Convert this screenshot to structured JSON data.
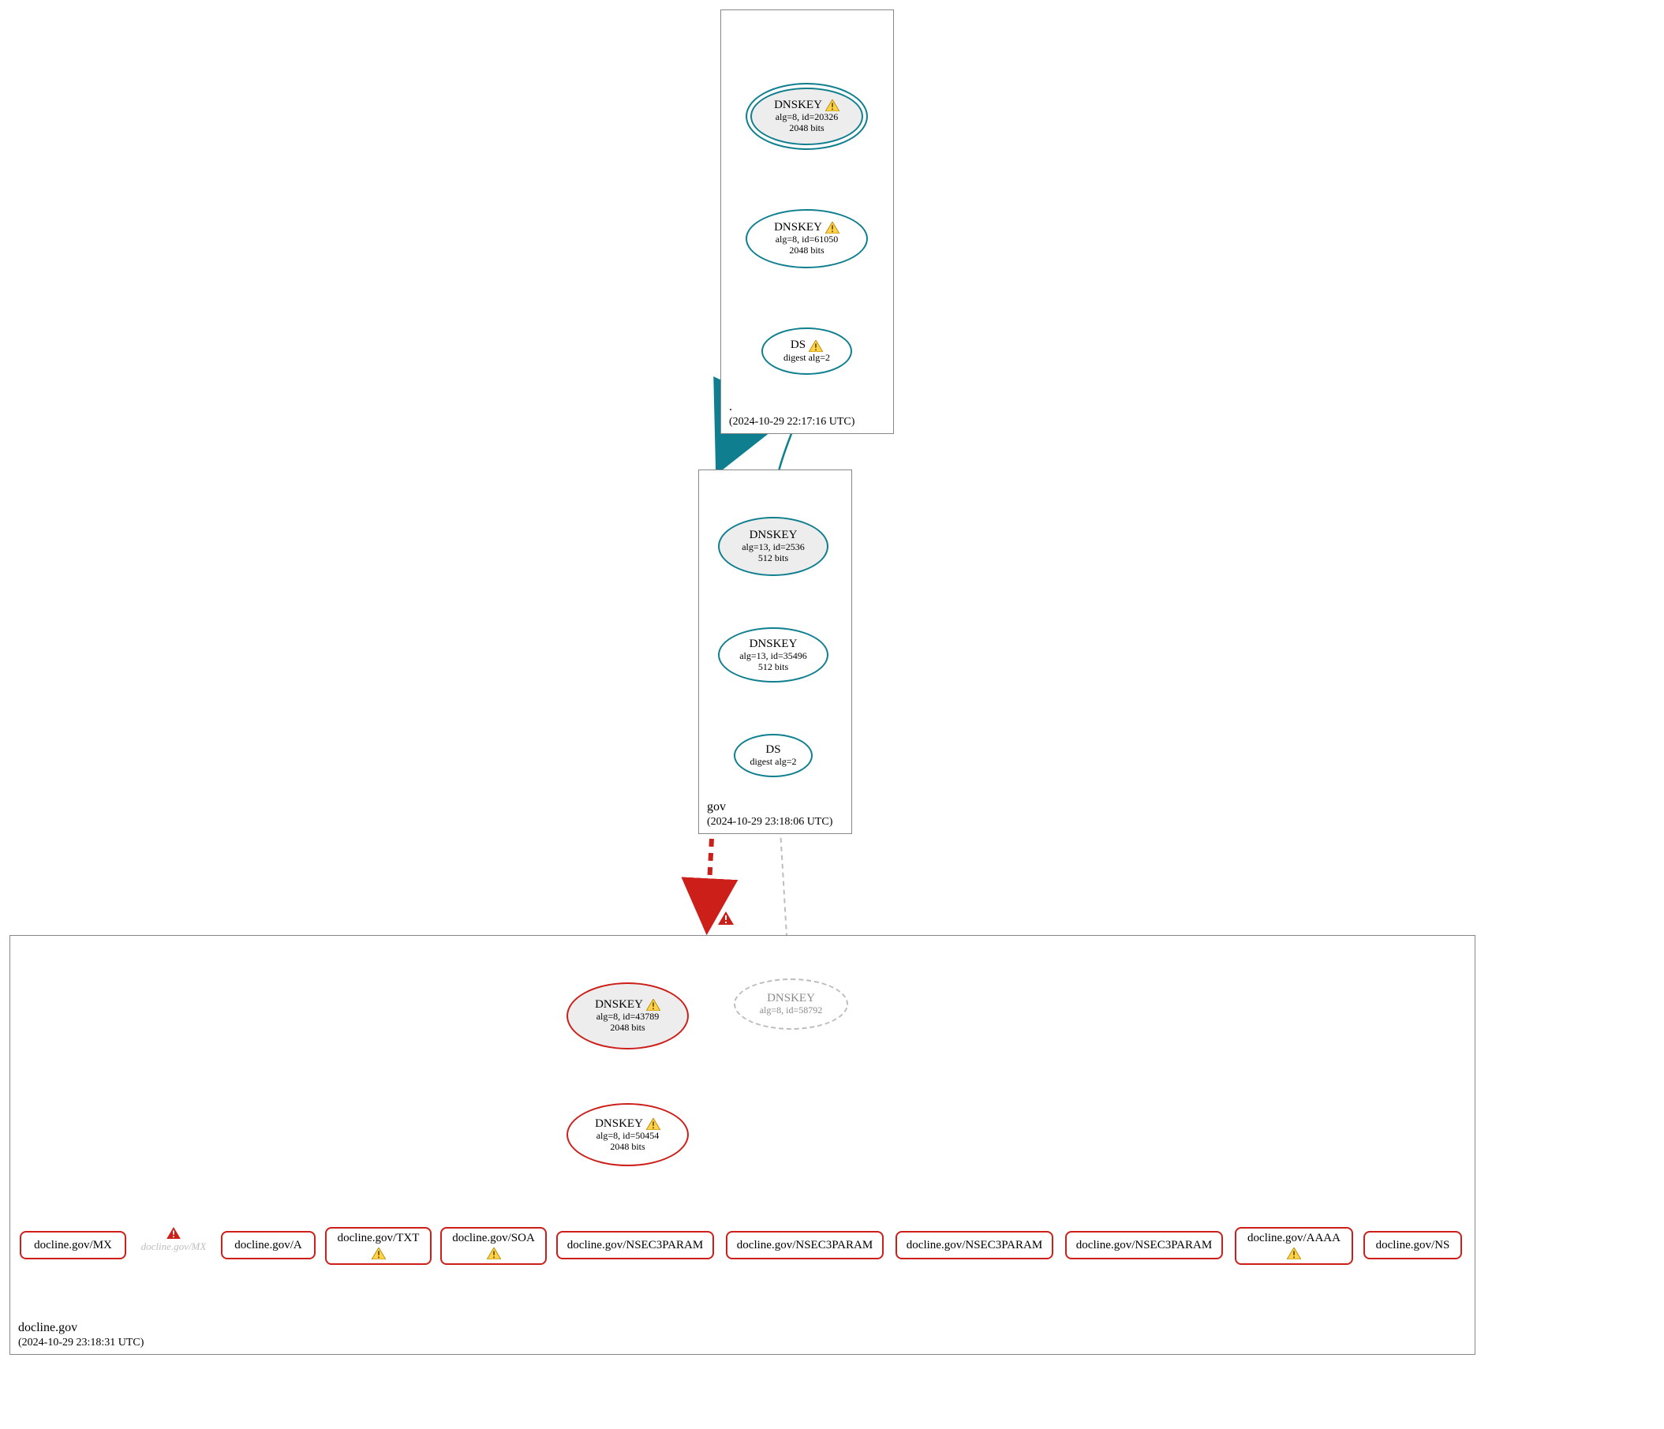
{
  "zones": {
    "root": {
      "label": ".",
      "timestamp": "(2024-10-29 22:17:16 UTC)"
    },
    "gov": {
      "label": "gov",
      "timestamp": "(2024-10-29 23:18:06 UTC)"
    },
    "docline": {
      "label": "docline.gov",
      "timestamp": "(2024-10-29 23:18:31 UTC)"
    }
  },
  "nodes": {
    "root_ksk": {
      "title": "DNSKEY",
      "line1": "alg=8, id=20326",
      "line2": "2048 bits",
      "warn": true
    },
    "root_zsk": {
      "title": "DNSKEY",
      "line1": "alg=8, id=61050",
      "line2": "2048 bits",
      "warn": true
    },
    "root_ds": {
      "title": "DS",
      "line1": "digest alg=2",
      "line2": "",
      "warn": true
    },
    "gov_ksk": {
      "title": "DNSKEY",
      "line1": "alg=13, id=2536",
      "line2": "512 bits",
      "warn": false
    },
    "gov_zsk": {
      "title": "DNSKEY",
      "line1": "alg=13, id=35496",
      "line2": "512 bits",
      "warn": false
    },
    "gov_ds": {
      "title": "DS",
      "line1": "digest alg=2",
      "line2": "",
      "warn": false
    },
    "doc_ksk": {
      "title": "DNSKEY",
      "line1": "alg=8, id=43789",
      "line2": "2048 bits",
      "warn": true
    },
    "doc_zsk": {
      "title": "DNSKEY",
      "line1": "alg=8, id=50454",
      "line2": "2048 bits",
      "warn": true
    },
    "doc_inact": {
      "title": "DNSKEY",
      "line1": "alg=8, id=58792",
      "line2": "",
      "warn": false
    }
  },
  "rrs": {
    "mx": {
      "label": "docline.gov/MX",
      "warn": false
    },
    "a": {
      "label": "docline.gov/A",
      "warn": false
    },
    "txt": {
      "label": "docline.gov/TXT",
      "warn": true
    },
    "soa": {
      "label": "docline.gov/SOA",
      "warn": true
    },
    "n3p1": {
      "label": "docline.gov/NSEC3PARAM",
      "warn": false
    },
    "n3p2": {
      "label": "docline.gov/NSEC3PARAM",
      "warn": false
    },
    "n3p3": {
      "label": "docline.gov/NSEC3PARAM",
      "warn": false
    },
    "n3p4": {
      "label": "docline.gov/NSEC3PARAM",
      "warn": false
    },
    "aaaa": {
      "label": "docline.gov/AAAA",
      "warn": true
    },
    "ns": {
      "label": "docline.gov/NS",
      "warn": false
    }
  },
  "mx_ghost_label": "docline.gov/MX",
  "colors": {
    "teal": "#0f7f8f",
    "red": "#cc1f1a",
    "grey": "#bdbdbd"
  }
}
